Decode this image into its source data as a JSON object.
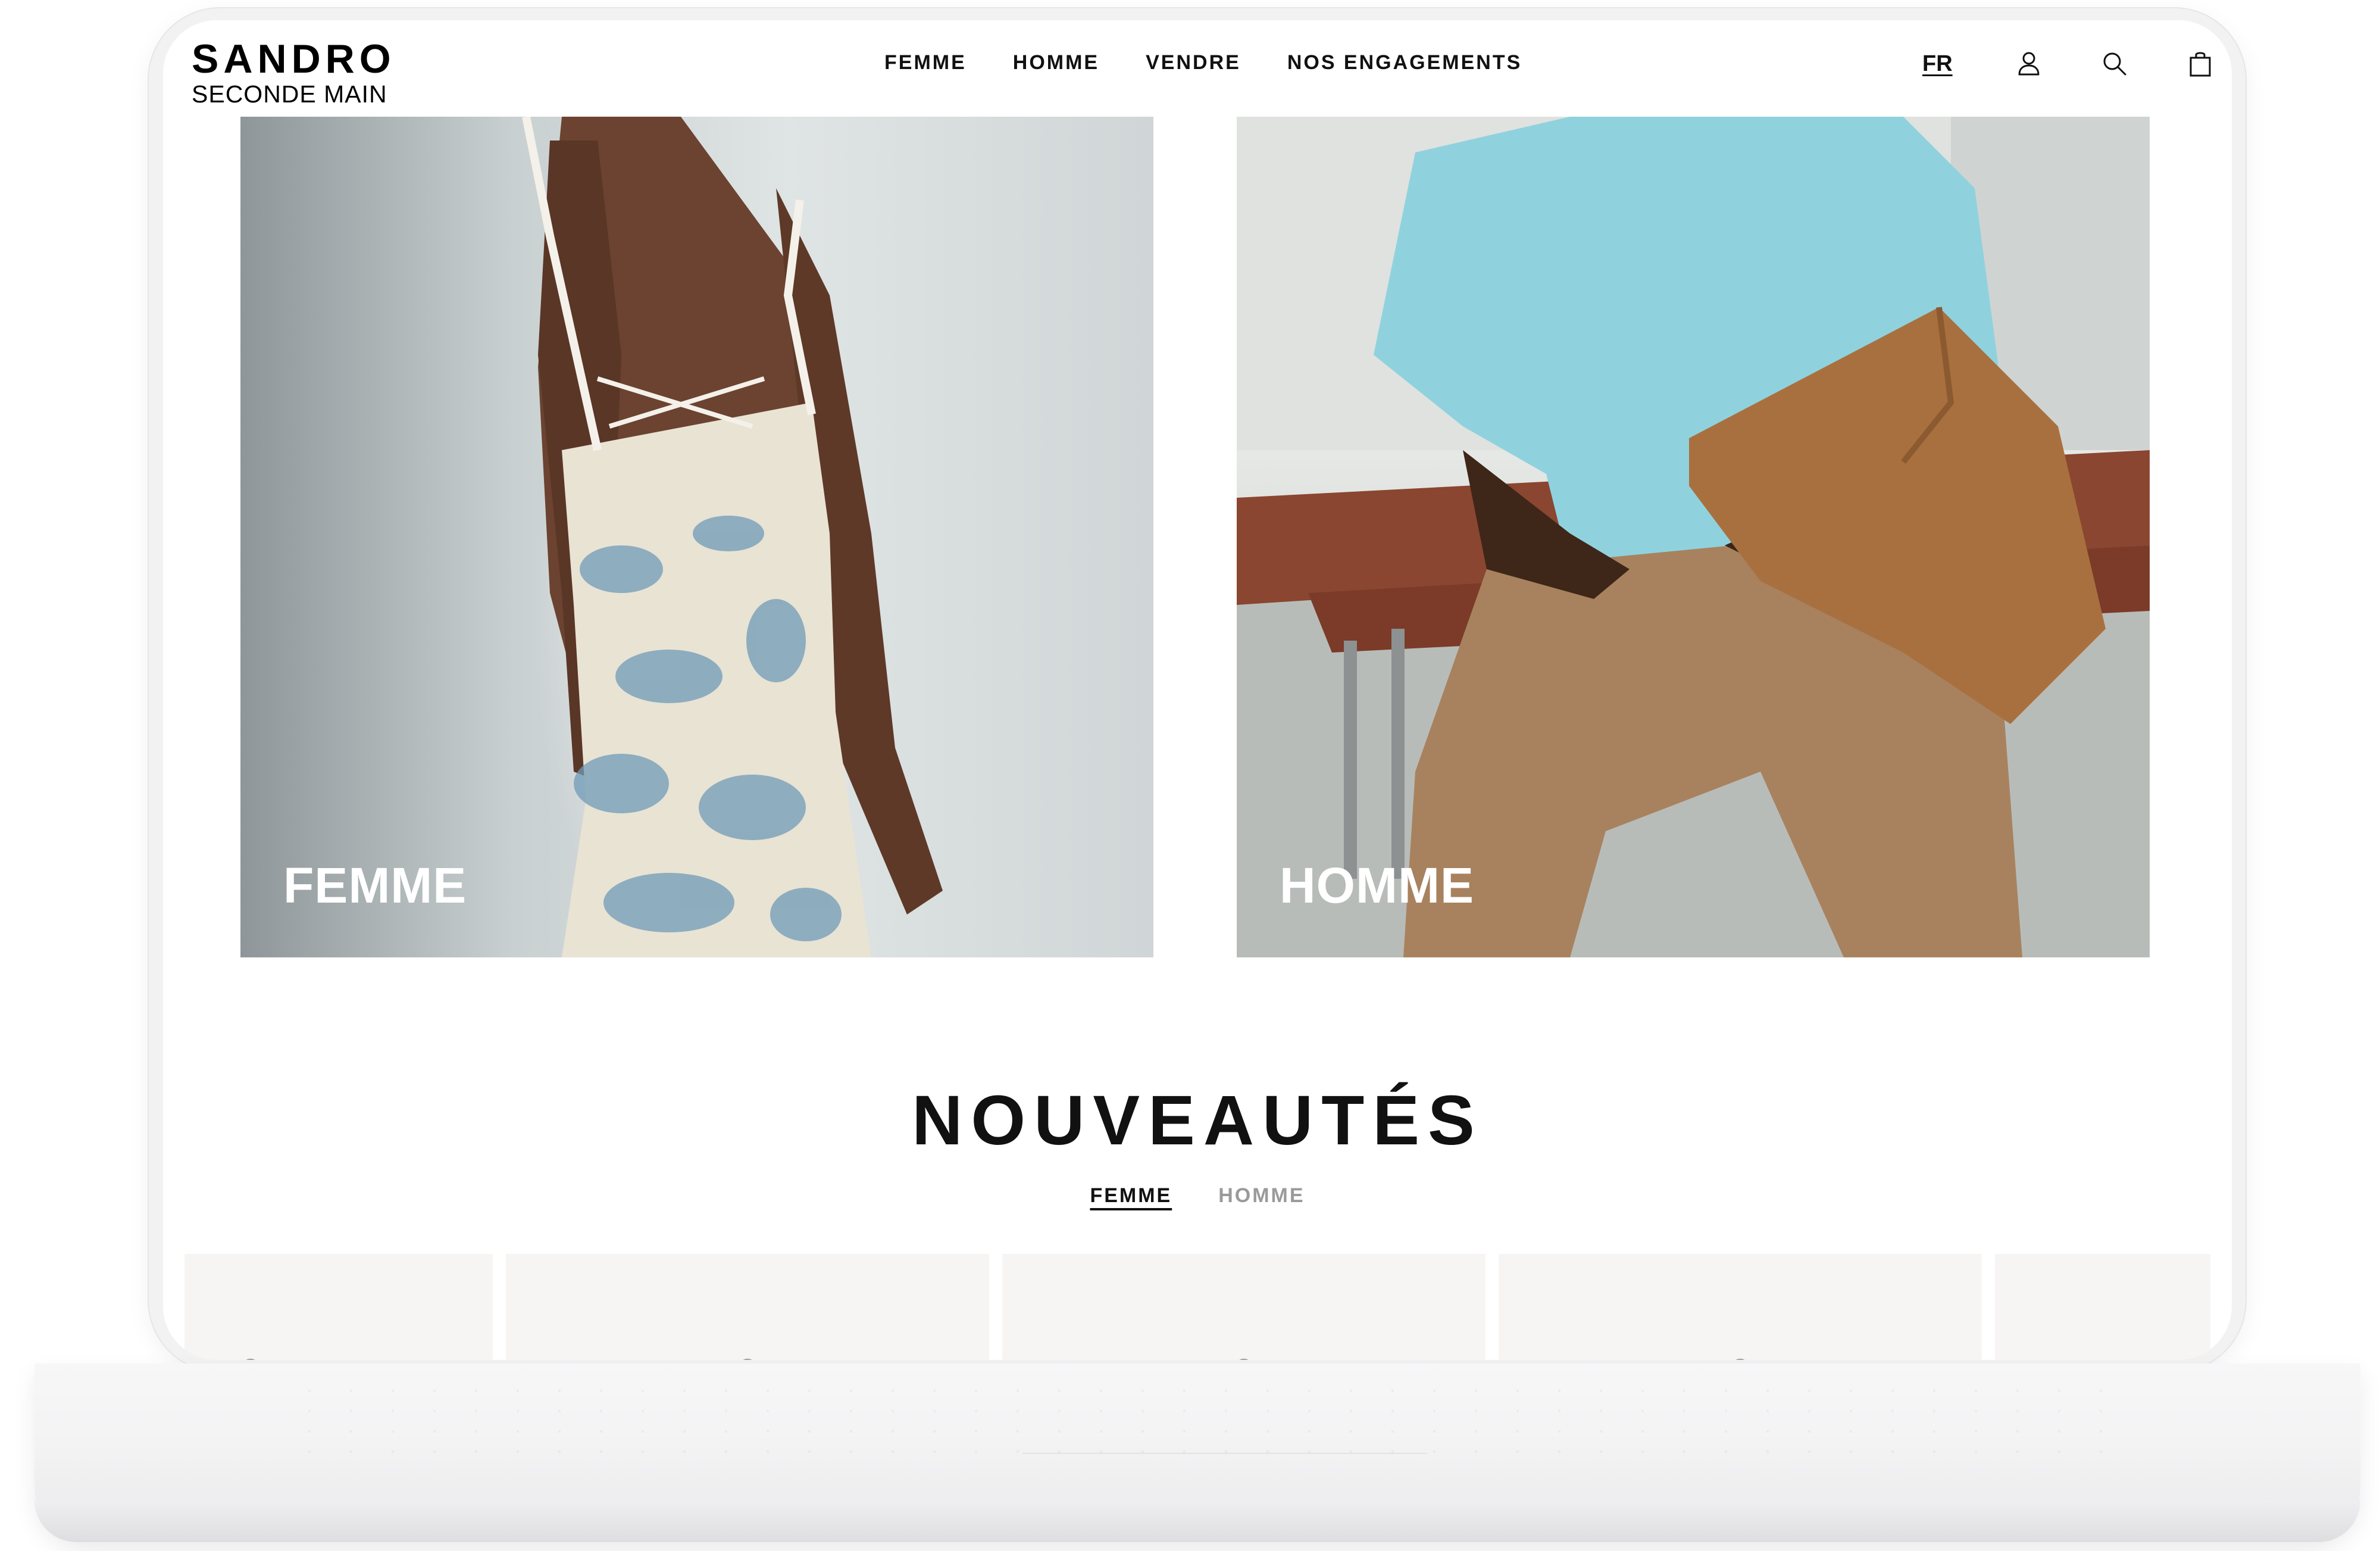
{
  "header": {
    "logo_top": "SANDRO",
    "logo_bottom": "SECONDE MAIN",
    "nav": [
      "FEMME",
      "HOMME",
      "VENDRE",
      "NOS ENGAGEMENTS"
    ],
    "language": "FR",
    "icons": [
      "account-icon",
      "search-icon",
      "shopping-bag-icon"
    ]
  },
  "categories": [
    {
      "label": "FEMME"
    },
    {
      "label": "HOMME"
    }
  ],
  "new_arrivals": {
    "title": "NOUVEAUTÉS",
    "tabs": [
      "FEMME",
      "HOMME"
    ],
    "active_tab": "FEMME"
  },
  "colors": {
    "text": "#111111",
    "tab_inactive": "#9a9a9a",
    "background": "#ffffff"
  }
}
